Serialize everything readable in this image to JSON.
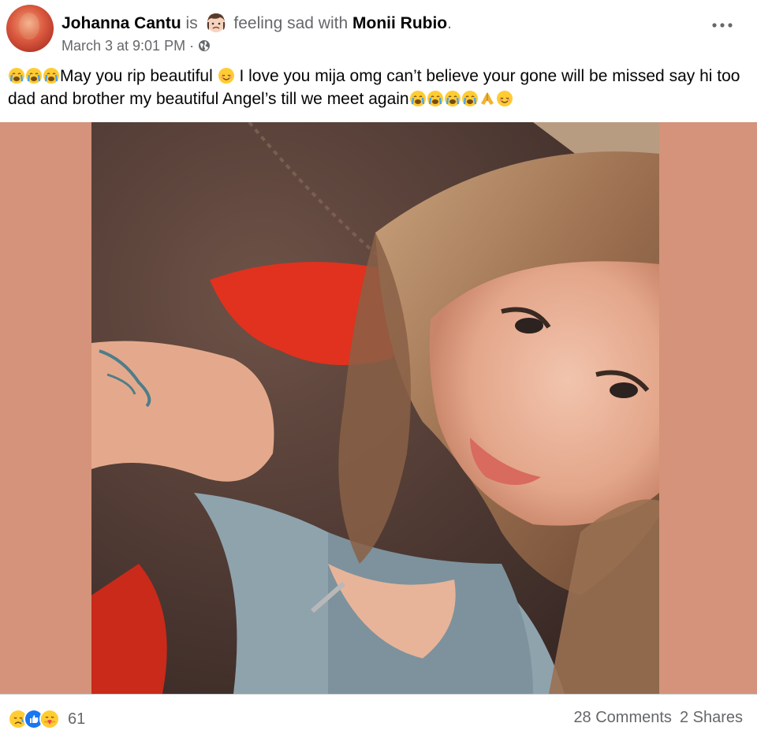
{
  "post": {
    "author": "Johanna Cantu",
    "is_text": "is",
    "feeling_text": "feeling sad with",
    "tagged": "Monii Rubio",
    "period": ".",
    "date": "March 3 at 9:01 PM",
    "separator": "·",
    "privacy_icon": "globe-icon",
    "text_part1": "May you rip beautiful",
    "text_part2": "I love you mija omg can’t believe your gone will be missed say hi too dad and brother my beautiful Angel’s till we meet again"
  },
  "footer": {
    "reaction_icons": [
      "sad-reaction-icon",
      "like-reaction-icon",
      "care-reaction-icon"
    ],
    "reaction_count": "61",
    "comments": "28 Comments",
    "shares": "2 Shares"
  },
  "colors": {
    "photo_background": "#d4937a",
    "muted_text": "#65676b",
    "like_blue": "#1877f2",
    "emoji_yellow": "#ffcc33"
  }
}
